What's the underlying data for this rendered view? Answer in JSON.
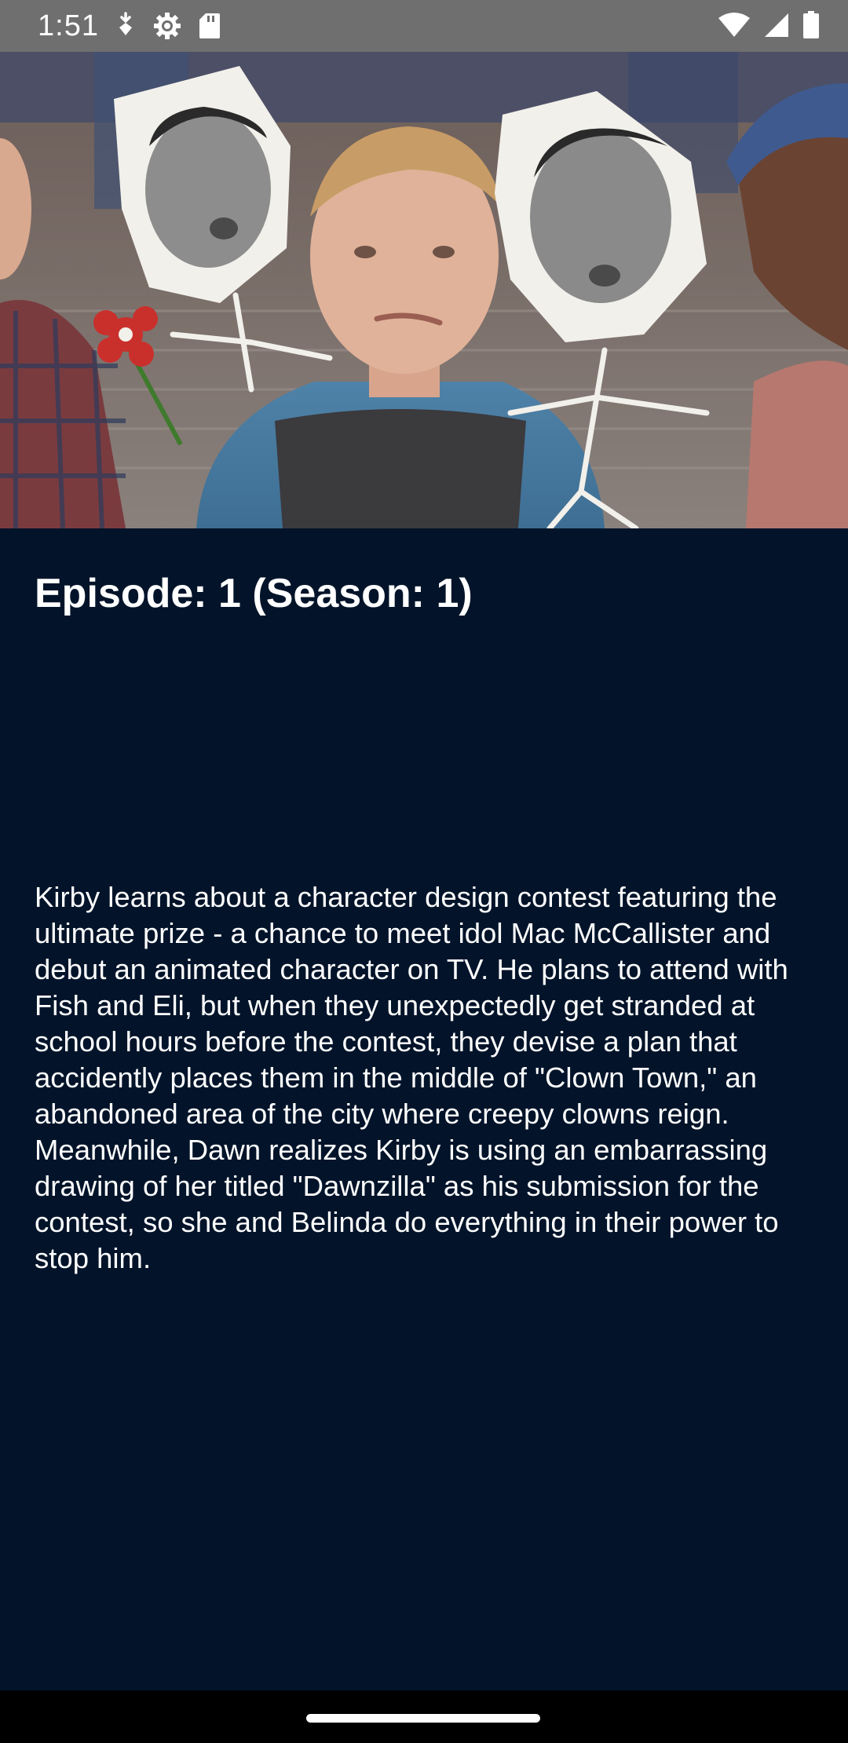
{
  "status_bar": {
    "time": "1:51",
    "icons": [
      "data-saver-icon",
      "settings-gear-icon",
      "sd-card-icon",
      "wifi-icon",
      "cellular-signal-icon",
      "battery-icon"
    ]
  },
  "hero": {
    "image": "episode-still-image",
    "colors": {
      "background": "#5a4d49",
      "paper": "#f2f0ea"
    }
  },
  "episode": {
    "title": "Episode: 1 (Season: 1)",
    "description": "Kirby learns about a character design contest featuring the ultimate prize - a chance to meet idol Mac McCallister and debut an animated character on TV. He plans to attend with Fish and Eli, but when they unexpectedly get stranded at school hours before the contest, they devise a plan that accidently places them in the middle of \"Clown Town,\" an abandoned area of the city where creepy clowns reign. Meanwhile, Dawn realizes Kirby is using an embarrassing drawing of her titled \"Dawnzilla\" as his submission for the contest, so she and Belinda do everything in their power to stop him."
  },
  "theme": {
    "background": "#03142a",
    "status_bar": "#6f6f6f",
    "text": "#ffffff",
    "nav_bar": "#000000"
  }
}
